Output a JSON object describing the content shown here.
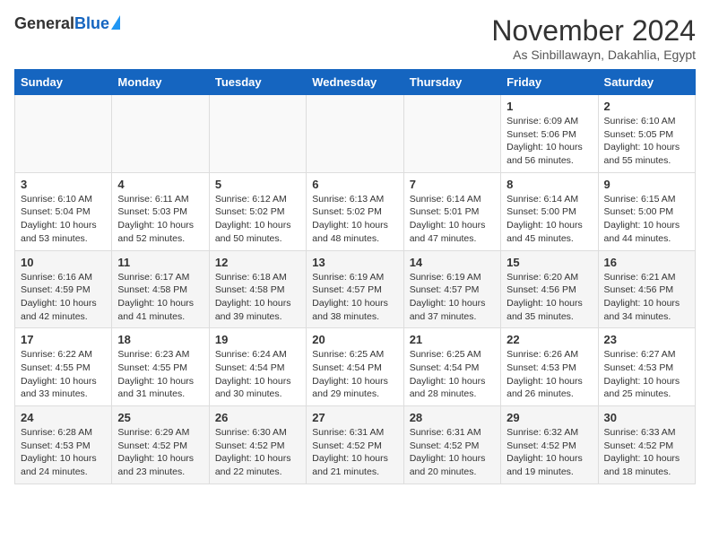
{
  "header": {
    "logo_general": "General",
    "logo_blue": "Blue",
    "month": "November 2024",
    "location": "As Sinbillawayn, Dakahlia, Egypt"
  },
  "days_of_week": [
    "Sunday",
    "Monday",
    "Tuesday",
    "Wednesday",
    "Thursday",
    "Friday",
    "Saturday"
  ],
  "weeks": [
    [
      {
        "day": "",
        "empty": true
      },
      {
        "day": "",
        "empty": true
      },
      {
        "day": "",
        "empty": true
      },
      {
        "day": "",
        "empty": true
      },
      {
        "day": "",
        "empty": true
      },
      {
        "day": "1",
        "sunrise": "Sunrise: 6:09 AM",
        "sunset": "Sunset: 5:06 PM",
        "daylight": "Daylight: 10 hours and 56 minutes."
      },
      {
        "day": "2",
        "sunrise": "Sunrise: 6:10 AM",
        "sunset": "Sunset: 5:05 PM",
        "daylight": "Daylight: 10 hours and 55 minutes."
      }
    ],
    [
      {
        "day": "3",
        "sunrise": "Sunrise: 6:10 AM",
        "sunset": "Sunset: 5:04 PM",
        "daylight": "Daylight: 10 hours and 53 minutes."
      },
      {
        "day": "4",
        "sunrise": "Sunrise: 6:11 AM",
        "sunset": "Sunset: 5:03 PM",
        "daylight": "Daylight: 10 hours and 52 minutes."
      },
      {
        "day": "5",
        "sunrise": "Sunrise: 6:12 AM",
        "sunset": "Sunset: 5:02 PM",
        "daylight": "Daylight: 10 hours and 50 minutes."
      },
      {
        "day": "6",
        "sunrise": "Sunrise: 6:13 AM",
        "sunset": "Sunset: 5:02 PM",
        "daylight": "Daylight: 10 hours and 48 minutes."
      },
      {
        "day": "7",
        "sunrise": "Sunrise: 6:14 AM",
        "sunset": "Sunset: 5:01 PM",
        "daylight": "Daylight: 10 hours and 47 minutes."
      },
      {
        "day": "8",
        "sunrise": "Sunrise: 6:14 AM",
        "sunset": "Sunset: 5:00 PM",
        "daylight": "Daylight: 10 hours and 45 minutes."
      },
      {
        "day": "9",
        "sunrise": "Sunrise: 6:15 AM",
        "sunset": "Sunset: 5:00 PM",
        "daylight": "Daylight: 10 hours and 44 minutes."
      }
    ],
    [
      {
        "day": "10",
        "sunrise": "Sunrise: 6:16 AM",
        "sunset": "Sunset: 4:59 PM",
        "daylight": "Daylight: 10 hours and 42 minutes."
      },
      {
        "day": "11",
        "sunrise": "Sunrise: 6:17 AM",
        "sunset": "Sunset: 4:58 PM",
        "daylight": "Daylight: 10 hours and 41 minutes."
      },
      {
        "day": "12",
        "sunrise": "Sunrise: 6:18 AM",
        "sunset": "Sunset: 4:58 PM",
        "daylight": "Daylight: 10 hours and 39 minutes."
      },
      {
        "day": "13",
        "sunrise": "Sunrise: 6:19 AM",
        "sunset": "Sunset: 4:57 PM",
        "daylight": "Daylight: 10 hours and 38 minutes."
      },
      {
        "day": "14",
        "sunrise": "Sunrise: 6:19 AM",
        "sunset": "Sunset: 4:57 PM",
        "daylight": "Daylight: 10 hours and 37 minutes."
      },
      {
        "day": "15",
        "sunrise": "Sunrise: 6:20 AM",
        "sunset": "Sunset: 4:56 PM",
        "daylight": "Daylight: 10 hours and 35 minutes."
      },
      {
        "day": "16",
        "sunrise": "Sunrise: 6:21 AM",
        "sunset": "Sunset: 4:56 PM",
        "daylight": "Daylight: 10 hours and 34 minutes."
      }
    ],
    [
      {
        "day": "17",
        "sunrise": "Sunrise: 6:22 AM",
        "sunset": "Sunset: 4:55 PM",
        "daylight": "Daylight: 10 hours and 33 minutes."
      },
      {
        "day": "18",
        "sunrise": "Sunrise: 6:23 AM",
        "sunset": "Sunset: 4:55 PM",
        "daylight": "Daylight: 10 hours and 31 minutes."
      },
      {
        "day": "19",
        "sunrise": "Sunrise: 6:24 AM",
        "sunset": "Sunset: 4:54 PM",
        "daylight": "Daylight: 10 hours and 30 minutes."
      },
      {
        "day": "20",
        "sunrise": "Sunrise: 6:25 AM",
        "sunset": "Sunset: 4:54 PM",
        "daylight": "Daylight: 10 hours and 29 minutes."
      },
      {
        "day": "21",
        "sunrise": "Sunrise: 6:25 AM",
        "sunset": "Sunset: 4:54 PM",
        "daylight": "Daylight: 10 hours and 28 minutes."
      },
      {
        "day": "22",
        "sunrise": "Sunrise: 6:26 AM",
        "sunset": "Sunset: 4:53 PM",
        "daylight": "Daylight: 10 hours and 26 minutes."
      },
      {
        "day": "23",
        "sunrise": "Sunrise: 6:27 AM",
        "sunset": "Sunset: 4:53 PM",
        "daylight": "Daylight: 10 hours and 25 minutes."
      }
    ],
    [
      {
        "day": "24",
        "sunrise": "Sunrise: 6:28 AM",
        "sunset": "Sunset: 4:53 PM",
        "daylight": "Daylight: 10 hours and 24 minutes."
      },
      {
        "day": "25",
        "sunrise": "Sunrise: 6:29 AM",
        "sunset": "Sunset: 4:52 PM",
        "daylight": "Daylight: 10 hours and 23 minutes."
      },
      {
        "day": "26",
        "sunrise": "Sunrise: 6:30 AM",
        "sunset": "Sunset: 4:52 PM",
        "daylight": "Daylight: 10 hours and 22 minutes."
      },
      {
        "day": "27",
        "sunrise": "Sunrise: 6:31 AM",
        "sunset": "Sunset: 4:52 PM",
        "daylight": "Daylight: 10 hours and 21 minutes."
      },
      {
        "day": "28",
        "sunrise": "Sunrise: 6:31 AM",
        "sunset": "Sunset: 4:52 PM",
        "daylight": "Daylight: 10 hours and 20 minutes."
      },
      {
        "day": "29",
        "sunrise": "Sunrise: 6:32 AM",
        "sunset": "Sunset: 4:52 PM",
        "daylight": "Daylight: 10 hours and 19 minutes."
      },
      {
        "day": "30",
        "sunrise": "Sunrise: 6:33 AM",
        "sunset": "Sunset: 4:52 PM",
        "daylight": "Daylight: 10 hours and 18 minutes."
      }
    ]
  ]
}
